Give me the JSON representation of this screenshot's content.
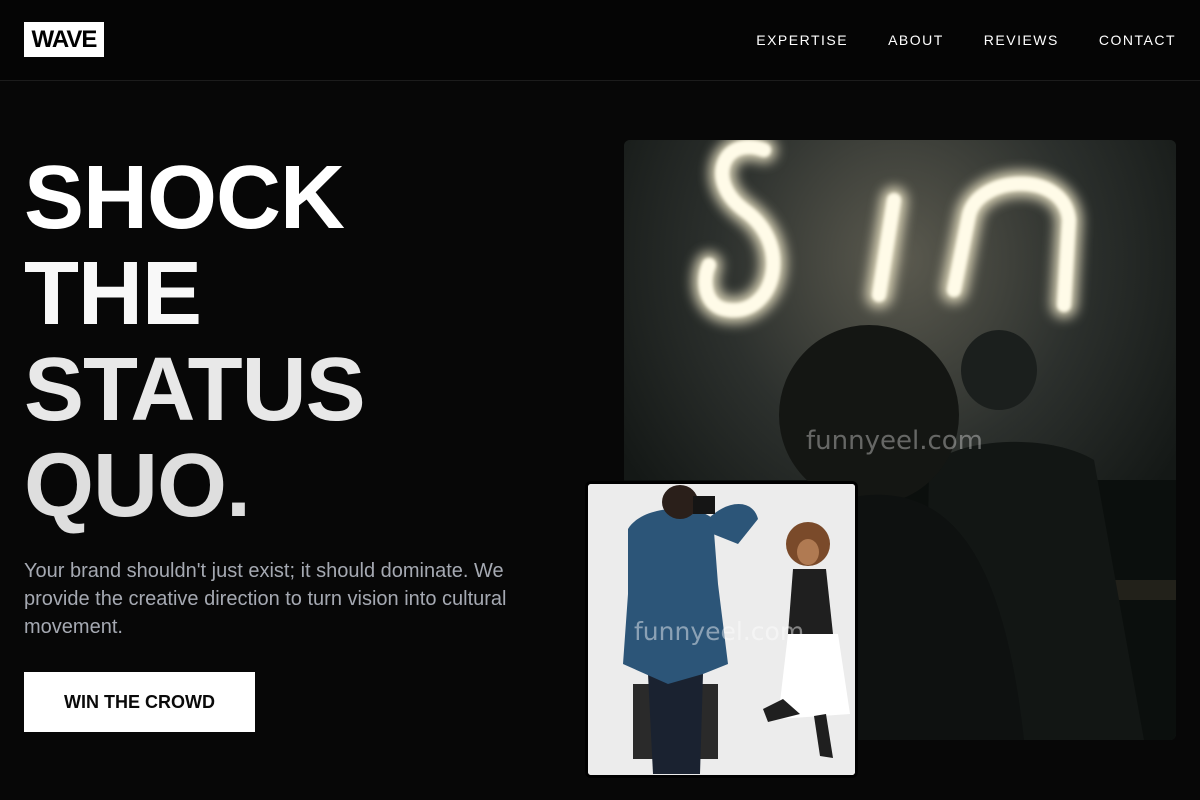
{
  "brand": {
    "logo_text": "WAVE"
  },
  "nav": {
    "items": [
      {
        "label": "EXPERTISE"
      },
      {
        "label": "ABOUT"
      },
      {
        "label": "REVIEWS"
      },
      {
        "label": "CONTACT"
      }
    ]
  },
  "hero": {
    "title_lines": [
      "SHOCK",
      "THE",
      "STATUS",
      "QUO."
    ],
    "description": "Your brand shouldn't just exist; it should dominate. We provide the creative direction to turn vision into cultural movement.",
    "cta_label": "WIN THE CROWD"
  },
  "images": {
    "main": {
      "neon_sign_text": "Sin"
    },
    "watermark_text": "funnyeel.com"
  },
  "colors": {
    "background": "#070707",
    "text": "#ffffff",
    "muted_text": "#a5a9b2",
    "cta_background": "#ffffff",
    "cta_text": "#0a0a0a"
  },
  "icons": []
}
